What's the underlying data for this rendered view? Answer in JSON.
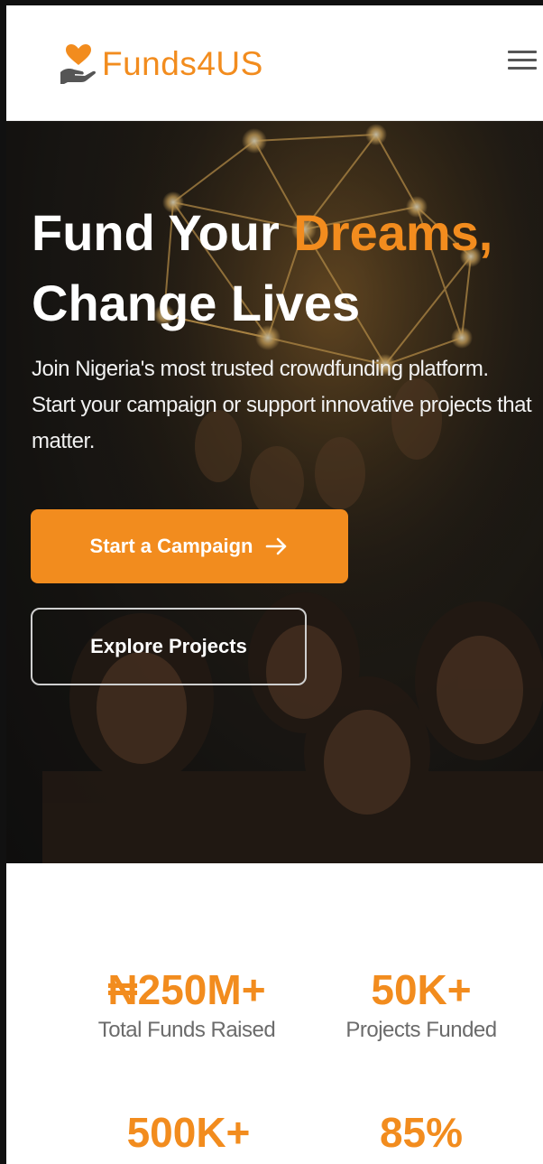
{
  "header": {
    "brand": "Funds4US",
    "logo_icon": "heart-hand-icon",
    "menu_icon": "hamburger-menu-icon",
    "brand_color": "#f28c1e"
  },
  "hero": {
    "title_part1": "Fund Your ",
    "title_accent": "Dreams,",
    "title_line2": "Change Lives",
    "description": "Join Nigeria's most trusted crowdfunding platform. Start your campaign or support innovative projects that matter.",
    "primary_button": "Start a Campaign",
    "primary_icon": "arrow-right-icon",
    "secondary_button": "Explore Projects"
  },
  "stats": [
    {
      "value": "₦250M+",
      "label": "Total Funds Raised"
    },
    {
      "value": "50K+",
      "label": "Projects Funded"
    },
    {
      "value": "500K+",
      "label": ""
    },
    {
      "value": "85%",
      "label": ""
    }
  ]
}
